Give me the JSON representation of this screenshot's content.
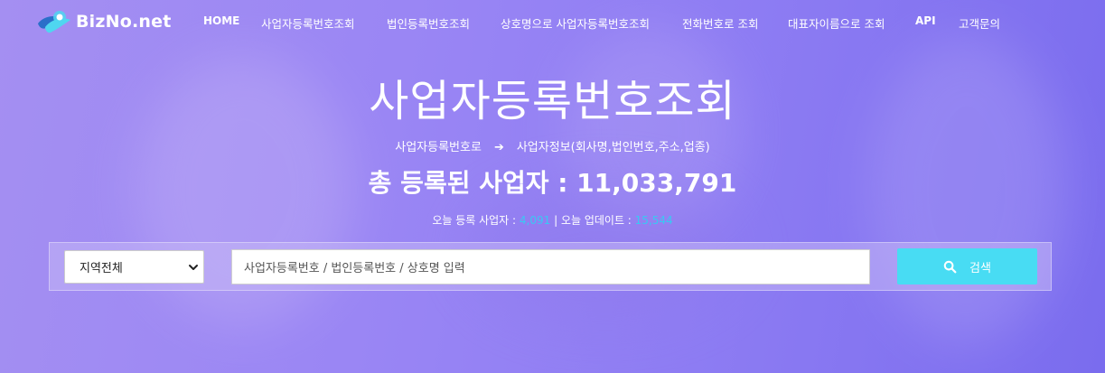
{
  "brand": {
    "name": "BizNo.net",
    "colors": {
      "logo_teal": "#4fd6f0",
      "logo_blue": "#2b6fc9",
      "accent": "#48dcf3",
      "highlight": "#38c9f3"
    }
  },
  "nav": {
    "items": [
      {
        "label": "HOME"
      },
      {
        "label": "사업자등록번호조회"
      },
      {
        "label": "법인등록번호조회"
      },
      {
        "label": "상호명으로 사업자등록번호조회"
      },
      {
        "label": "전화번호로 조회"
      },
      {
        "label": "대표자이름으로 조회"
      },
      {
        "label": "API"
      },
      {
        "label": "고객문의"
      }
    ]
  },
  "hero": {
    "title": "사업자등록번호조회",
    "subtitle_from": "사업자등록번호로",
    "subtitle_arrow": "➔",
    "subtitle_to": "사업자정보(회사명,법인번호,주소,업종)",
    "total_label": "총 등록된 사업자 : 11,033,791",
    "today_label": "오늘 등록 사업자 : ",
    "today_count": "4,091",
    "separator": " | ",
    "update_label": "오늘 업데이트 : ",
    "update_count": "15,544"
  },
  "search": {
    "region_selected": "지역전체",
    "placeholder": "사업자등록번호 / 법인등록번호 / 상호명 입력",
    "button_label": "검색",
    "button_icon": "search-icon"
  }
}
